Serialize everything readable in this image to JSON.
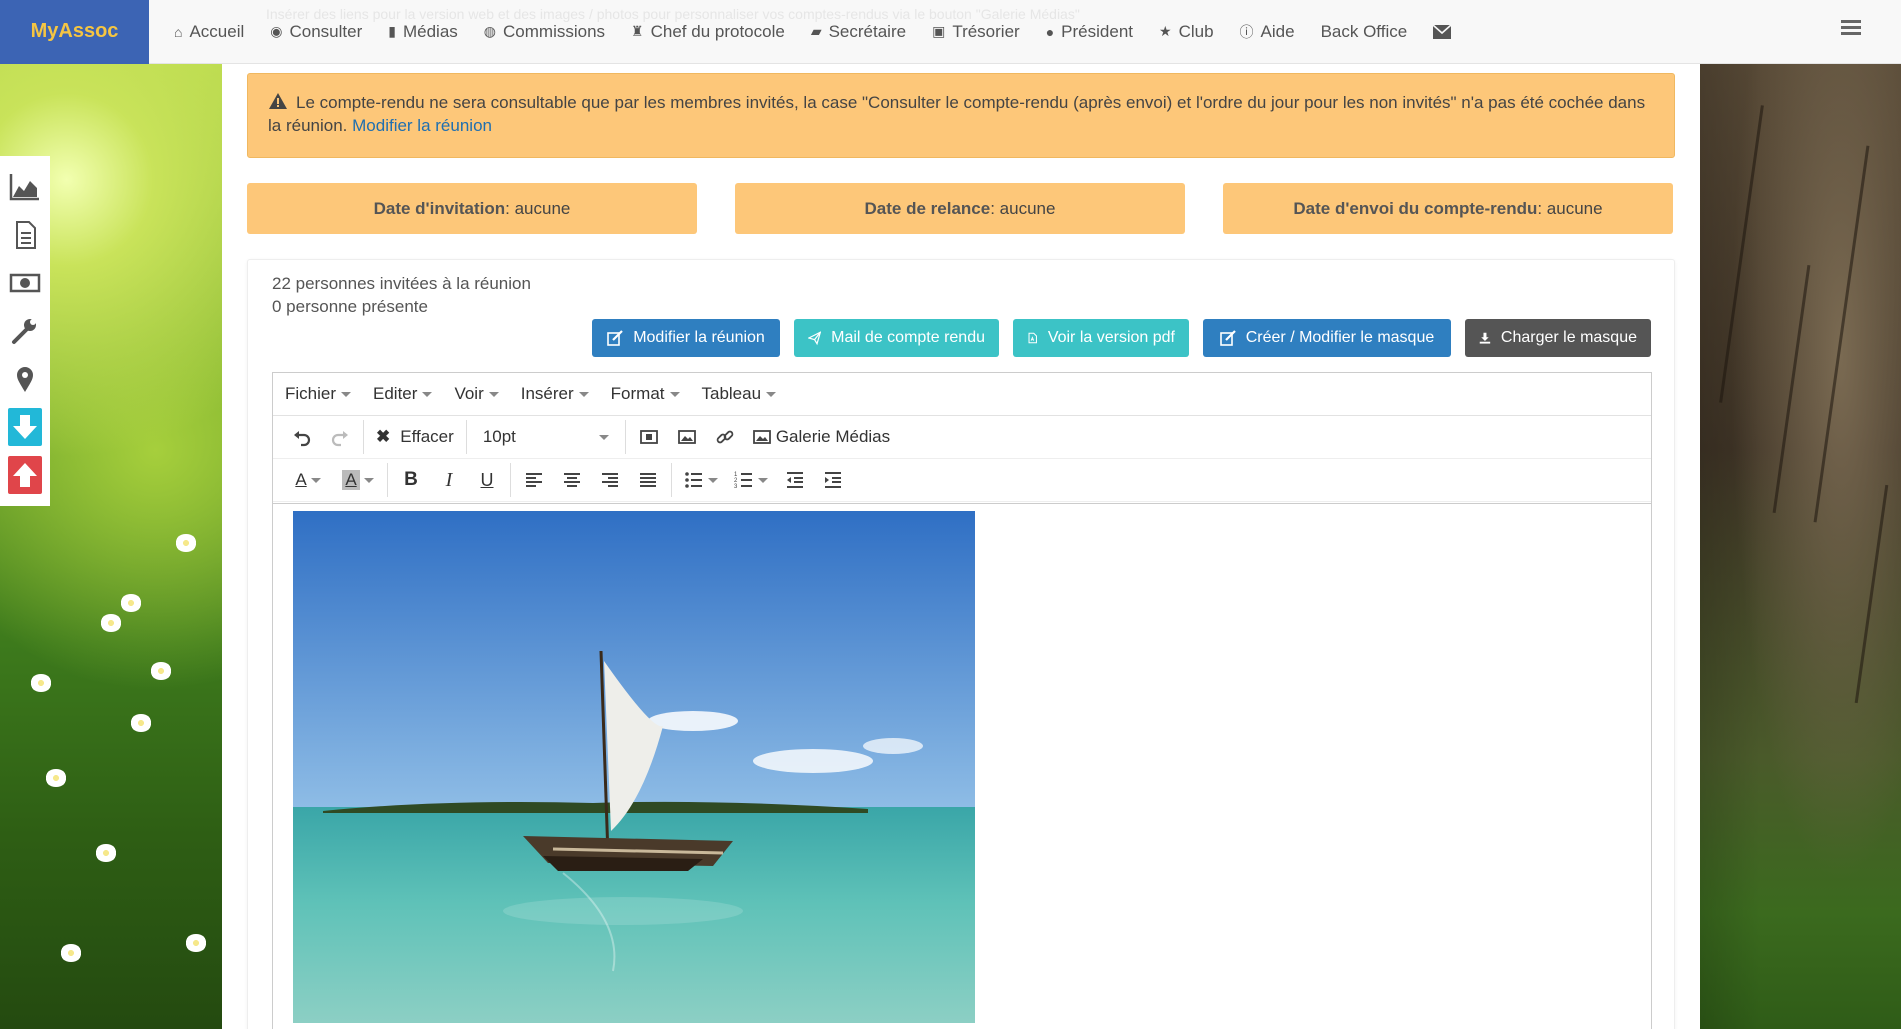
{
  "nav": {
    "brand": "MyAssoc",
    "items": [
      {
        "label": "Accueil",
        "icon": "home-icon"
      },
      {
        "label": "Consulter",
        "icon": "eye-icon"
      },
      {
        "label": "Médias",
        "icon": "file-icon"
      },
      {
        "label": "Commissions",
        "icon": "user-circle-icon"
      },
      {
        "label": "Chef du protocole",
        "icon": "trophy-icon"
      },
      {
        "label": "Secrétaire",
        "icon": "book-icon"
      },
      {
        "label": "Trésorier",
        "icon": "money-icon"
      },
      {
        "label": "Président",
        "icon": "globe-icon"
      },
      {
        "label": "Club",
        "icon": "star-icon"
      },
      {
        "label": "Aide",
        "icon": "info-icon"
      },
      {
        "label": "Back Office",
        "icon": ""
      }
    ],
    "faded_text": "Insérer des liens pour la version web et des images / photos pour personnaliser vos comptes-rendus via le bouton \"Galerie Médias\""
  },
  "alert": {
    "text": "Le compte-rendu ne sera consultable que par les membres invités, la case \"Consulter le compte-rendu (après envoi) et l'ordre du jour pour les non invités\" n'a pas été cochée dans la réunion.",
    "link": "Modifier la réunion"
  },
  "dates": [
    {
      "label": "Date d'invitation",
      "value": " : aucune"
    },
    {
      "label": "Date de relance",
      "value": " : aucune"
    },
    {
      "label": "Date d'envoi du compte-rendu",
      "value": " : aucune"
    }
  ],
  "stats": {
    "invited": "22 personnes invitées à la réunion",
    "present": "0 personne présente"
  },
  "buttons": {
    "edit_meeting": "Modifier la réunion",
    "mail_report": "Mail de compte rendu",
    "view_pdf": "Voir la version pdf",
    "edit_mask": "Créer / Modifier le masque",
    "load_mask": "Charger le masque"
  },
  "editor": {
    "menus": [
      "Fichier",
      "Editer",
      "Voir",
      "Insérer",
      "Format",
      "Tableau"
    ],
    "clear_label": "Effacer",
    "font_size": "10pt",
    "gallery_label": "Galerie Médias"
  },
  "colors": {
    "brand_bg": "#3c64b4",
    "brand_text": "#f5c542",
    "alert_bg": "#fdc779",
    "btn_blue": "#2f7fc0",
    "btn_teal": "#3cc3c6",
    "btn_dark": "#555555"
  }
}
